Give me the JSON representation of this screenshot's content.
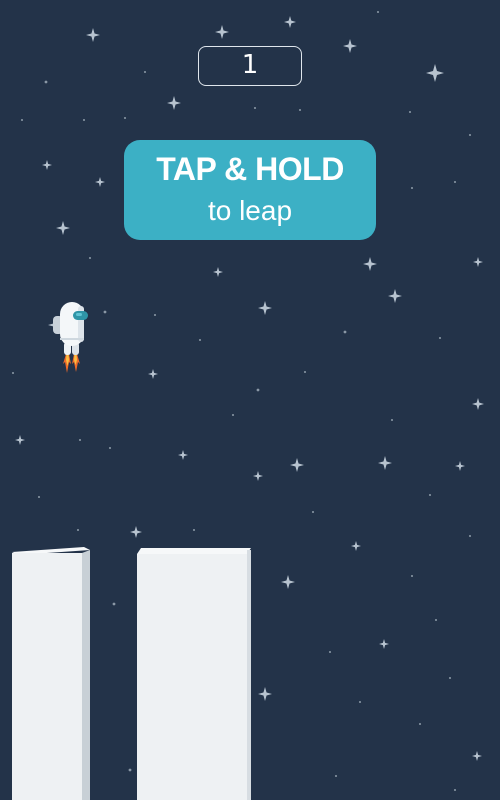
{
  "hud": {
    "score": "1"
  },
  "hint": {
    "title": "TAP & HOLD",
    "subtitle": "to leap"
  },
  "colors": {
    "background": "#233349",
    "hint_box": "#3cb0c5",
    "pillar": "#eef1f3",
    "star": "#b7c3cf"
  },
  "icons": {
    "player": "astronaut-jetpack-icon",
    "star": "sparkle-star-icon"
  }
}
